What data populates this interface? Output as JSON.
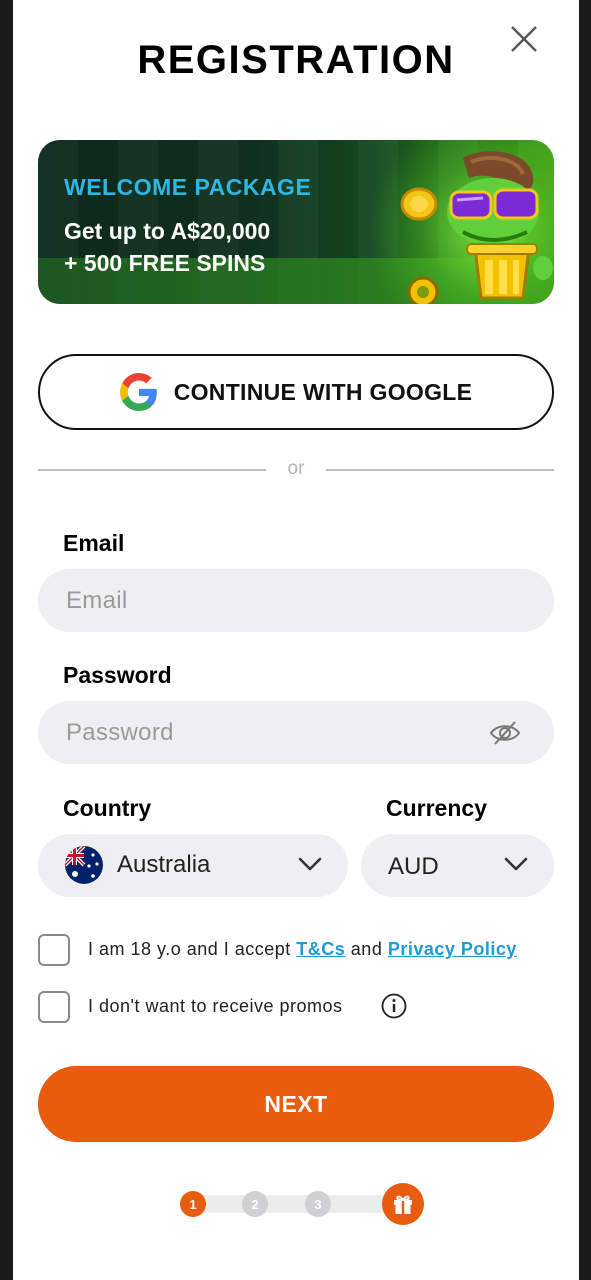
{
  "modal": {
    "title": "REGISTRATION"
  },
  "banner": {
    "label": "WELCOME PACKAGE",
    "line1": "Get up to A$20,000",
    "line2": "+ 500 FREE SPINS"
  },
  "google": {
    "label": "CONTINUE WITH GOOGLE"
  },
  "divider": {
    "text": "or"
  },
  "email": {
    "label": "Email",
    "placeholder": "Email",
    "value": ""
  },
  "password": {
    "label": "Password",
    "placeholder": "Password",
    "value": ""
  },
  "country": {
    "label": "Country",
    "value": "Australia"
  },
  "currency": {
    "label": "Currency",
    "value": "AUD"
  },
  "terms": {
    "prefix": "I am 18 y.o and I accept ",
    "tc_link": "T&Cs",
    "middle": " and ",
    "privacy_link": "Privacy Policy",
    "checked": false
  },
  "promos": {
    "text": "I don't want to receive promos",
    "checked": false
  },
  "next_button": {
    "label": "NEXT"
  },
  "steps": {
    "items": [
      "1",
      "2",
      "3"
    ],
    "current": 1,
    "final_icon": "gift-icon"
  },
  "colors": {
    "accent": "#e85c0d",
    "link": "#1e9bd4",
    "banner_label": "#2fb6e3",
    "input_bg": "#efeff1"
  }
}
